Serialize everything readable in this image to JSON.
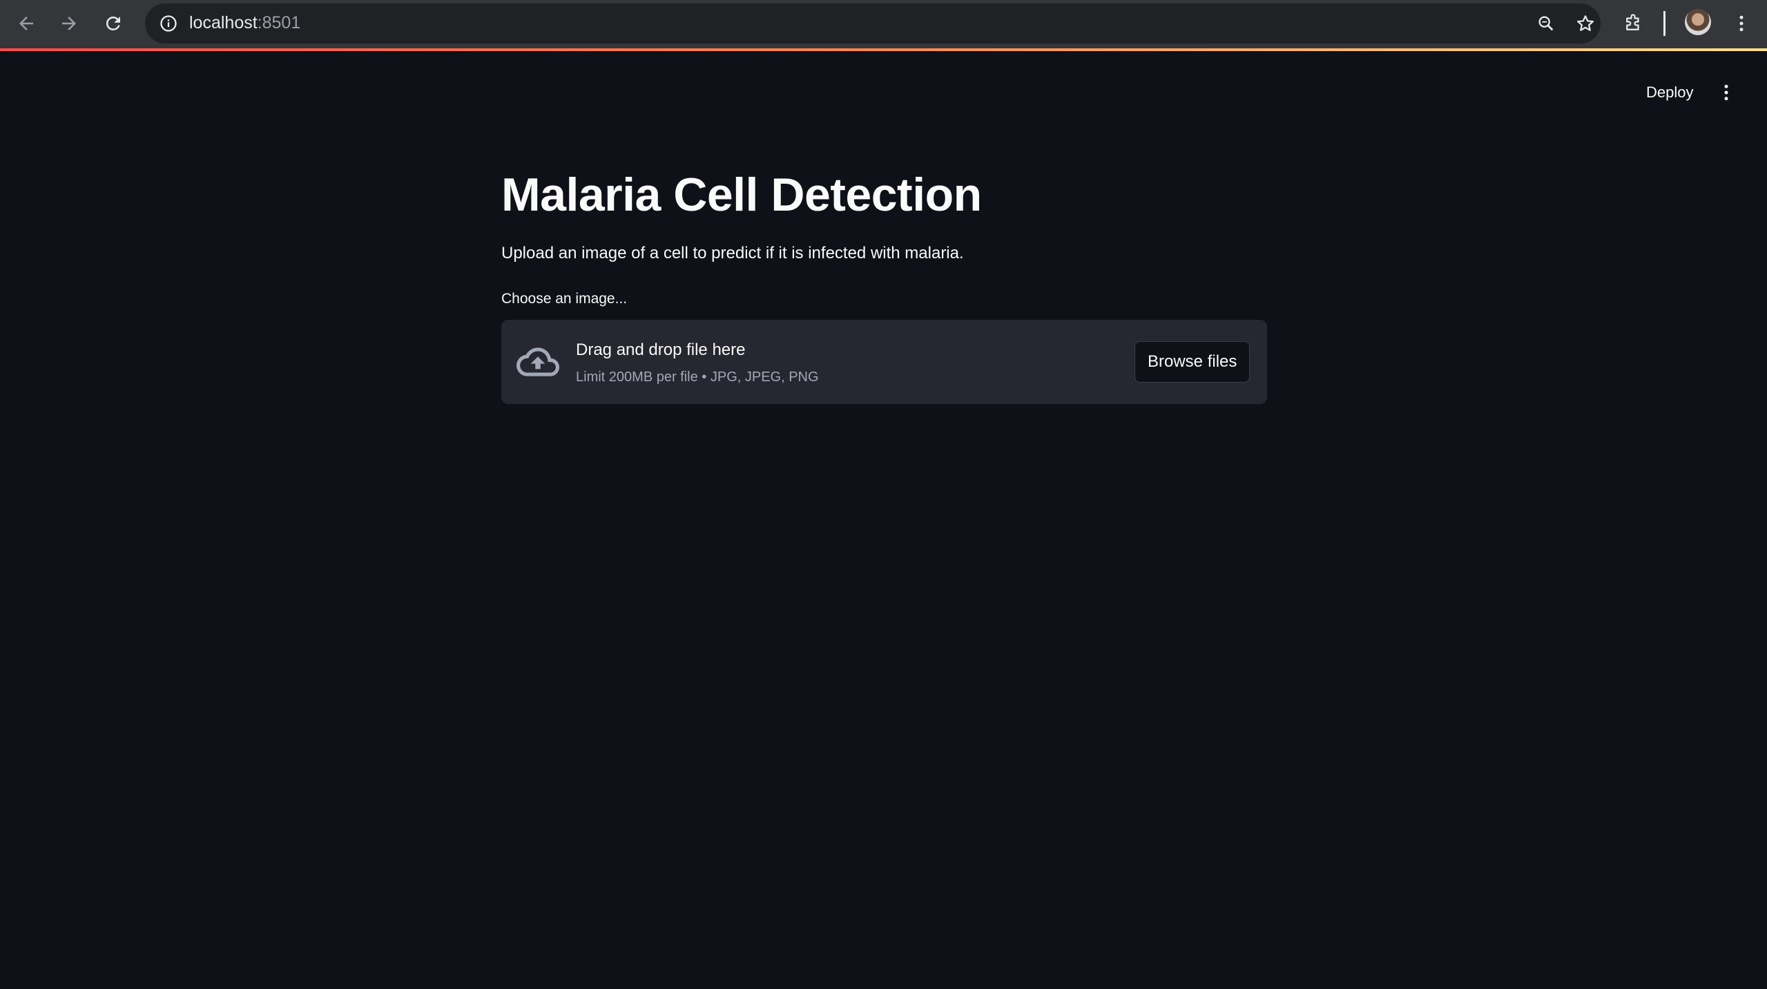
{
  "browser": {
    "url_host": "localhost",
    "url_port": ":8501",
    "icons": {
      "back": "back-arrow-icon",
      "forward": "forward-arrow-icon",
      "reload": "reload-icon",
      "site_info": "info-icon",
      "zoom": "magnifier-icon",
      "bookmark": "star-icon",
      "extensions": "puzzle-icon",
      "profile": "avatar",
      "menu": "kebab-icon"
    },
    "accent_gradient": [
      "#ff4b4b",
      "#ff8a4b",
      "#ffe08a"
    ]
  },
  "header": {
    "deploy_label": "Deploy",
    "menu_icon": "kebab-icon"
  },
  "main": {
    "title": "Malaria Cell Detection",
    "subtitle": "Upload an image of a cell to predict if it is infected with malaria.",
    "uploader": {
      "label": "Choose an image...",
      "drop_title": "Drag and drop file here",
      "limit_text": "Limit 200MB per file • JPG, JPEG, PNG",
      "browse_label": "Browse files",
      "icon": "cloud-upload-icon"
    }
  },
  "colors": {
    "background": "#0e1117",
    "dropzone": "#262730",
    "text": "#fafafa",
    "muted": "#a3a8b8"
  }
}
